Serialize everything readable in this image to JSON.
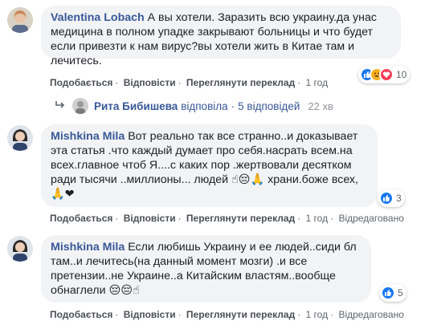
{
  "comments": [
    {
      "author": "Valentina Lobach",
      "text": "А вы хотели. Заразить всю украину.да унас медицина в полном упадке закрывают больницы и что будет если привезти к нам вирус?вы хотели жить в Китае там и лечитесь.",
      "emoji": "",
      "actions": {
        "like": "Подобається",
        "reply": "Відповісти",
        "translate": "Переглянути переклад",
        "time": "1 год",
        "edited": ""
      },
      "reactions": {
        "types": [
          "like-icon",
          "haha-icon",
          "love-icon"
        ],
        "count": "10"
      }
    },
    {
      "author": "Mishkina Mila",
      "text": "Вот реально так все странно..и доказывает эта статья .что каждый думает про себя.насрать всем.на всех.главное чтоб Я....с каких пор .жертвовали десятком ради тысячи ..миллионы... людей",
      "text2": "храни.боже всех,",
      "emoji": "☝😔🙏",
      "emoji2": "🙏❤",
      "actions": {
        "like": "Подобається",
        "reply": "Відповісти",
        "translate": "Переглянути переклад",
        "time": "1 год",
        "edited": "Відредаговано"
      },
      "reactions": {
        "types": [
          "like-icon"
        ],
        "count": "3"
      }
    },
    {
      "author": "Mishkina Mila",
      "text": "Если любишь Украину и ее людей..сиди бл там..и лечитесь(на данный момент мозги) .и все претензии..не Украине..а Китайским властям..вообще обнаглели",
      "emoji": "😔😔☝",
      "actions": {
        "like": "Подобається",
        "reply": "Відповісти",
        "translate": "Переглянути переклад",
        "time": "1 год",
        "edited": "Відредаговано"
      },
      "reactions": {
        "types": [
          "like-icon"
        ],
        "count": "5"
      }
    }
  ],
  "reply_summary": {
    "name": "Рита Бибишева",
    "verb": "відповіла",
    "dot": "·",
    "count_text": "5 відповідей",
    "time": "22 хв"
  },
  "separator": "·",
  "colors": {
    "link": "#385898",
    "bubble": "#f2f3f5",
    "like_blue": "#1877f2",
    "love_red": "#f33e58",
    "haha_yellow": "#f7b125"
  }
}
